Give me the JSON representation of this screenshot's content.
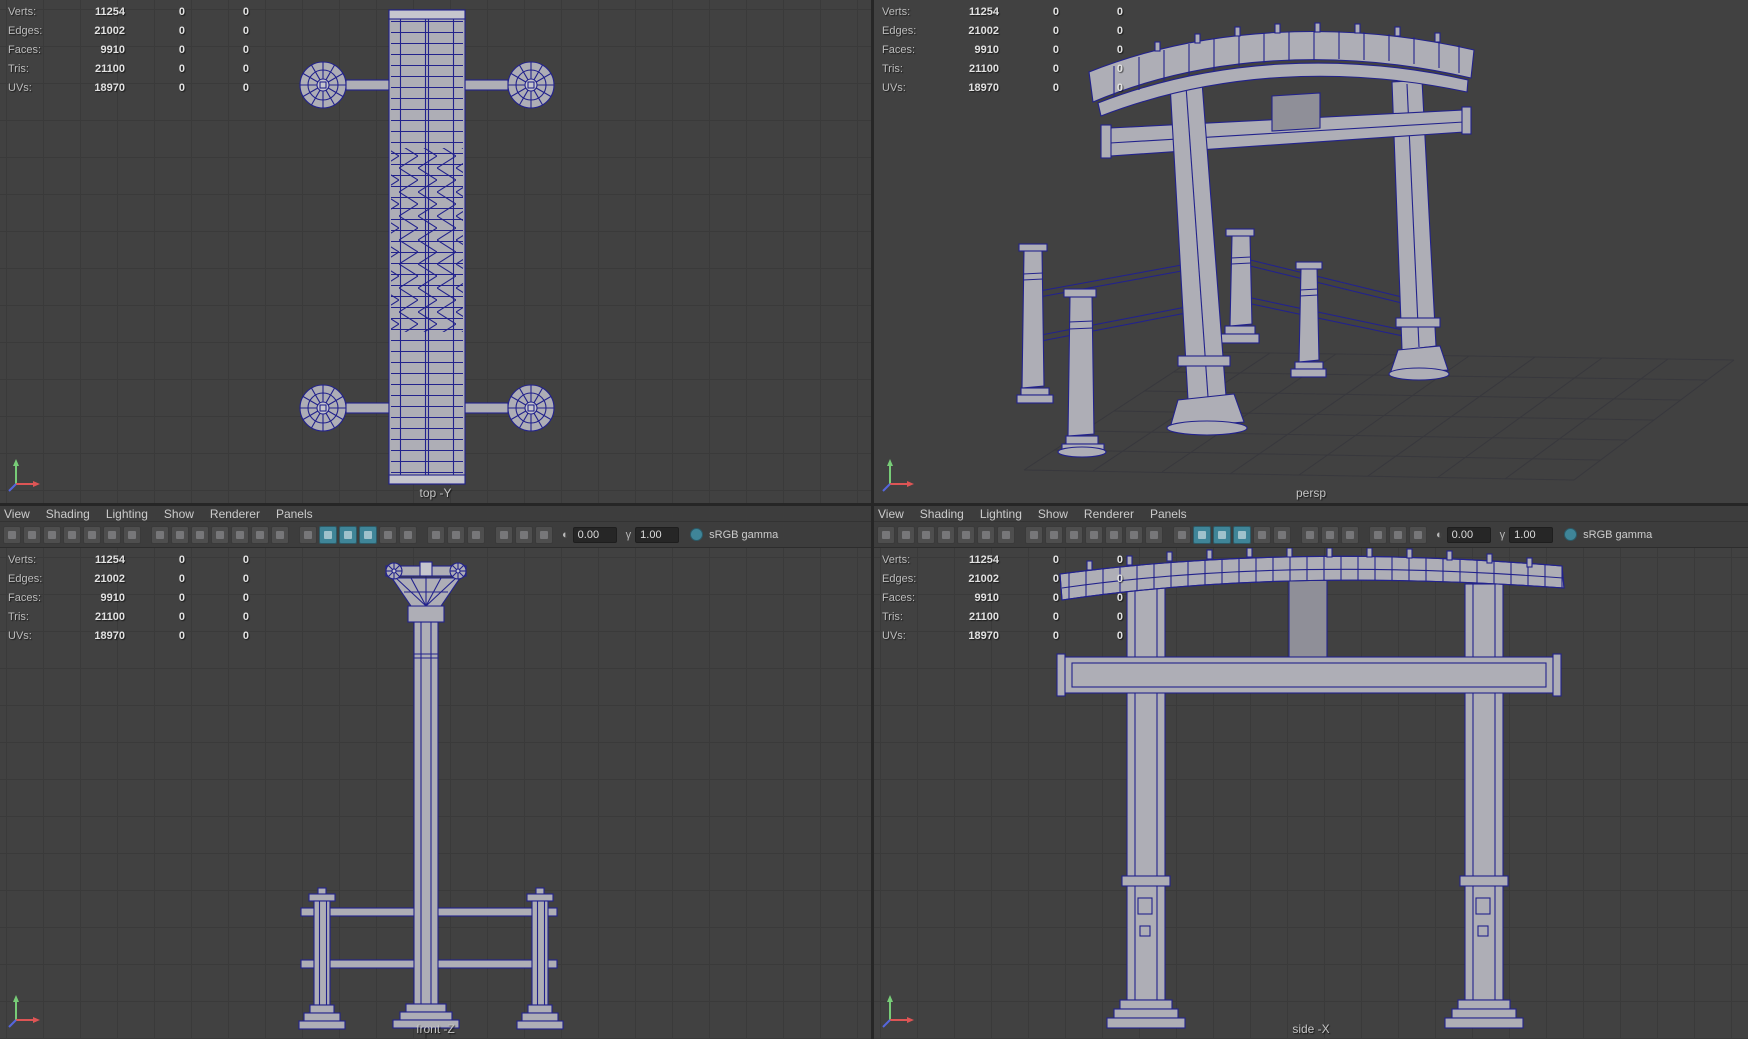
{
  "theme": {
    "viewport_bg": "#414141",
    "grid_line": "#3a3a3a",
    "grid_persp": "#38383d",
    "chrome_bg": "#3d3d3d",
    "chrome_border": "#2d2d2d",
    "divider": "#262626",
    "wire": "#22228c",
    "fill": "#aeaeb6",
    "fill_light": "#c6c6ce",
    "fill_dark": "#8f8f98",
    "accent": "#3f8598",
    "hud_label": "#bdbdbd",
    "hud_value": "#e2e2e2",
    "menu_text": "#cccccc",
    "field_bg": "#262626",
    "field_text": "#dddddd",
    "label_text": "#c4c4c4"
  },
  "hud": {
    "rows": [
      {
        "label": "Verts:",
        "c1": "11254",
        "c2": "0",
        "c3": "0"
      },
      {
        "label": "Edges:",
        "c1": "21002",
        "c2": "0",
        "c3": "0"
      },
      {
        "label": "Faces:",
        "c1": "9910",
        "c2": "0",
        "c3": "0"
      },
      {
        "label": "Tris:",
        "c1": "21100",
        "c2": "0",
        "c3": "0"
      },
      {
        "label": "UVs:",
        "c1": "18970",
        "c2": "0",
        "c3": "0"
      }
    ]
  },
  "panel_menu": {
    "items": [
      "View",
      "Shading",
      "Lighting",
      "Show",
      "Renderer",
      "Panels"
    ]
  },
  "panel_toolbar": {
    "icons": [
      {
        "name": "select-camera-icon",
        "active": false,
        "sep": false
      },
      {
        "name": "lock-camera-icon",
        "active": false,
        "sep": false
      },
      {
        "name": "camera-attributes-icon",
        "active": false,
        "sep": false
      },
      {
        "name": "bookmarks-icon",
        "active": false,
        "sep": false
      },
      {
        "name": "image-plane-icon",
        "active": false,
        "sep": false
      },
      {
        "name": "2d-pan-zoom-icon",
        "active": false,
        "sep": false
      },
      {
        "name": "grease-pencil-icon",
        "active": false,
        "sep": false
      },
      {
        "name": "grid-icon",
        "active": false,
        "sep": true
      },
      {
        "name": "film-gate-icon",
        "active": false,
        "sep": false
      },
      {
        "name": "resolution-gate-icon",
        "active": false,
        "sep": false
      },
      {
        "name": "gate-mask-icon",
        "active": false,
        "sep": false
      },
      {
        "name": "field-chart-icon",
        "active": false,
        "sep": false
      },
      {
        "name": "safe-action-icon",
        "active": false,
        "sep": false
      },
      {
        "name": "safe-title-icon",
        "active": false,
        "sep": false
      },
      {
        "name": "wireframe-icon",
        "active": false,
        "sep": true
      },
      {
        "name": "shaded-icon",
        "active": true,
        "sep": false
      },
      {
        "name": "textured-icon",
        "active": true,
        "sep": false
      },
      {
        "name": "use-all-lights-icon",
        "active": true,
        "sep": false
      },
      {
        "name": "shadows-icon",
        "active": false,
        "sep": false
      },
      {
        "name": "screen-space-ao-icon",
        "active": false,
        "sep": false
      },
      {
        "name": "motion-blur-icon",
        "active": false,
        "sep": true
      },
      {
        "name": "multisample-aa-icon",
        "active": false,
        "sep": false
      },
      {
        "name": "depth-of-field-icon",
        "active": false,
        "sep": false
      },
      {
        "name": "isolate-select-icon",
        "active": false,
        "sep": true
      },
      {
        "name": "xray-icon",
        "active": false,
        "sep": false
      },
      {
        "name": "joints-xray-icon",
        "active": false,
        "sep": false
      }
    ],
    "exposure_value": "0.00",
    "gamma_value": "1.00",
    "gamma_label": "sRGB gamma"
  },
  "viewports": {
    "top": {
      "label": "top -Y"
    },
    "persp": {
      "label": "persp"
    },
    "front": {
      "label": "front -Z"
    },
    "side": {
      "label": "side -X"
    }
  }
}
